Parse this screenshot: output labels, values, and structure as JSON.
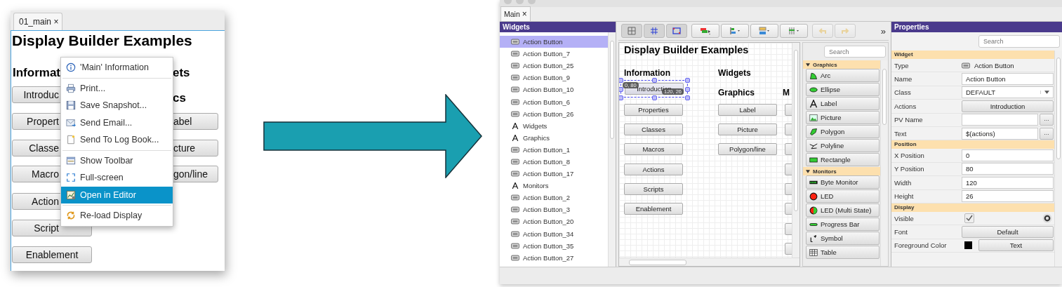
{
  "runtime_window": {
    "tab": {
      "label": "01_main",
      "close": "×"
    },
    "display": {
      "title": "Display Builder Examples",
      "heading_1": "Informat",
      "heading_2": "ets",
      "heading_3": "cs",
      "left_buttons": [
        {
          "label": "Introduc",
          "covered": true
        },
        {
          "label": "Propert",
          "covered": true
        },
        {
          "label": "Classe",
          "covered": true
        },
        {
          "label": "Macro",
          "covered": true
        },
        {
          "label": "Action",
          "covered": true
        },
        {
          "label": "Script",
          "covered": true
        },
        {
          "label": "Enablement",
          "covered": false
        }
      ],
      "right_buttons": [
        {
          "label": "abel",
          "covered": true
        },
        {
          "label": "cture",
          "covered": true
        },
        {
          "label": "gon/line",
          "covered": true
        }
      ]
    },
    "context_menu": {
      "groups": [
        [
          {
            "kind": "info",
            "label": "'Main' Information",
            "selected": false
          }
        ],
        [
          {
            "kind": "print",
            "label": "Print...",
            "selected": false
          },
          {
            "kind": "save",
            "label": "Save Snapshot...",
            "selected": false
          },
          {
            "kind": "email",
            "label": "Send Email...",
            "selected": false
          },
          {
            "kind": "logbook",
            "label": "Send To Log Book...",
            "selected": false
          }
        ],
        [
          {
            "kind": "toolbar",
            "label": "Show Toolbar",
            "selected": false
          },
          {
            "kind": "fullscreen",
            "label": "Full-screen",
            "selected": false
          },
          {
            "kind": "editor",
            "label": "Open in Editor",
            "selected": true
          }
        ],
        [
          {
            "kind": "reload",
            "label": "Re-load Display",
            "selected": false
          }
        ]
      ]
    }
  },
  "editor_window": {
    "tab": {
      "label": "Main",
      "close": "×"
    },
    "widgets_panel": {
      "title": "Widgets",
      "items": [
        {
          "kind": "action_button",
          "label": "Action Button",
          "selected": true
        },
        {
          "kind": "action_button",
          "label": "Action Button_7",
          "selected": false
        },
        {
          "kind": "action_button",
          "label": "Action Button_25",
          "selected": false
        },
        {
          "kind": "action_button",
          "label": "Action Button_9",
          "selected": false
        },
        {
          "kind": "action_button",
          "label": "Action Button_10",
          "selected": false
        },
        {
          "kind": "action_button",
          "label": "Action Button_6",
          "selected": false
        },
        {
          "kind": "action_button",
          "label": "Action Button_26",
          "selected": false
        },
        {
          "kind": "label",
          "label": "Widgets",
          "selected": false
        },
        {
          "kind": "label",
          "label": "Graphics",
          "selected": false
        },
        {
          "kind": "action_button",
          "label": "Action Button_1",
          "selected": false
        },
        {
          "kind": "action_button",
          "label": "Action Button_8",
          "selected": false
        },
        {
          "kind": "action_button",
          "label": "Action Button_17",
          "selected": false
        },
        {
          "kind": "label",
          "label": "Monitors",
          "selected": false
        },
        {
          "kind": "action_button",
          "label": "Action Button_2",
          "selected": false
        },
        {
          "kind": "action_button",
          "label": "Action Button_3",
          "selected": false
        },
        {
          "kind": "action_button",
          "label": "Action Button_20",
          "selected": false
        },
        {
          "kind": "action_button",
          "label": "Action Button_34",
          "selected": false
        },
        {
          "kind": "action_button",
          "label": "Action Button_35",
          "selected": false
        },
        {
          "kind": "action_button",
          "label": "Action Button_27",
          "selected": false
        }
      ]
    },
    "toolbar": {
      "overflow": "»"
    },
    "canvas": {
      "title": "Display Builder Examples",
      "heading_1": "Information",
      "heading_2": "Widgets",
      "heading_3": "Graphics",
      "heading_4": "M",
      "selection": {
        "position": "0, 80",
        "size": "120, 26"
      },
      "column_1_buttons": [
        {
          "label": "Introduction",
          "selected": true
        },
        {
          "label": "Properties",
          "selected": false
        },
        {
          "label": "Classes",
          "selected": false
        },
        {
          "label": "Macros",
          "selected": false
        },
        {
          "label": "Actions",
          "selected": false
        },
        {
          "label": "Scripts",
          "selected": false
        },
        {
          "label": "Enablement",
          "selected": false
        }
      ],
      "column_2_buttons": [
        {
          "label": "Label"
        },
        {
          "label": "Picture"
        },
        {
          "label": "Polygon/line"
        }
      ]
    },
    "palette": {
      "search_placeholder": "Search",
      "groups": [
        {
          "title": "Graphics",
          "expanded": true,
          "items": [
            {
              "kind": "arc",
              "label": "Arc"
            },
            {
              "kind": "ellipse",
              "label": "Ellipse"
            },
            {
              "kind": "label",
              "label": "Label"
            },
            {
              "kind": "picture",
              "label": "Picture"
            },
            {
              "kind": "polygon",
              "label": "Polygon"
            },
            {
              "kind": "polyline",
              "label": "Polyline"
            },
            {
              "kind": "rectangle",
              "label": "Rectangle"
            }
          ]
        },
        {
          "title": "Monitors",
          "expanded": true,
          "items": [
            {
              "kind": "byte_monitor",
              "label": "Byte Monitor"
            },
            {
              "kind": "led",
              "label": "LED"
            },
            {
              "kind": "led_multi",
              "label": "LED (Multi State)"
            },
            {
              "kind": "progress_bar",
              "label": "Progress Bar"
            },
            {
              "kind": "symbol",
              "label": "Symbol"
            },
            {
              "kind": "table",
              "label": "Table"
            }
          ]
        }
      ]
    },
    "properties": {
      "title": "Properties",
      "search_placeholder": "Search",
      "sections": [
        {
          "title": "Widget",
          "rows": [
            {
              "kind": "type",
              "name": "Type",
              "value": "Action Button"
            },
            {
              "kind": "field",
              "name": "Name",
              "value": "Action Button"
            },
            {
              "kind": "dropdown",
              "name": "Class",
              "value": "DEFAULT"
            },
            {
              "kind": "button",
              "name": "Actions",
              "value": "Introduction"
            },
            {
              "kind": "field_more",
              "name": "PV Name",
              "button": "..."
            },
            {
              "kind": "field_more",
              "name": "Text",
              "value": "$(actions)",
              "button": "..."
            }
          ]
        },
        {
          "title": "Position",
          "rows": [
            {
              "kind": "field",
              "name": "X Position",
              "value": "0"
            },
            {
              "kind": "field",
              "name": "Y Position",
              "value": "80"
            },
            {
              "kind": "field",
              "name": "Width",
              "value": "120"
            },
            {
              "kind": "field",
              "name": "Height",
              "value": "26"
            }
          ]
        },
        {
          "title": "Display",
          "rows": [
            {
              "kind": "checkbox",
              "name": "Visible",
              "checked": true
            },
            {
              "kind": "button",
              "name": "Font",
              "value": "Default"
            },
            {
              "kind": "color_button",
              "name": "Foreground Color",
              "color": "#000000",
              "value": "Text"
            }
          ]
        }
      ]
    }
  }
}
